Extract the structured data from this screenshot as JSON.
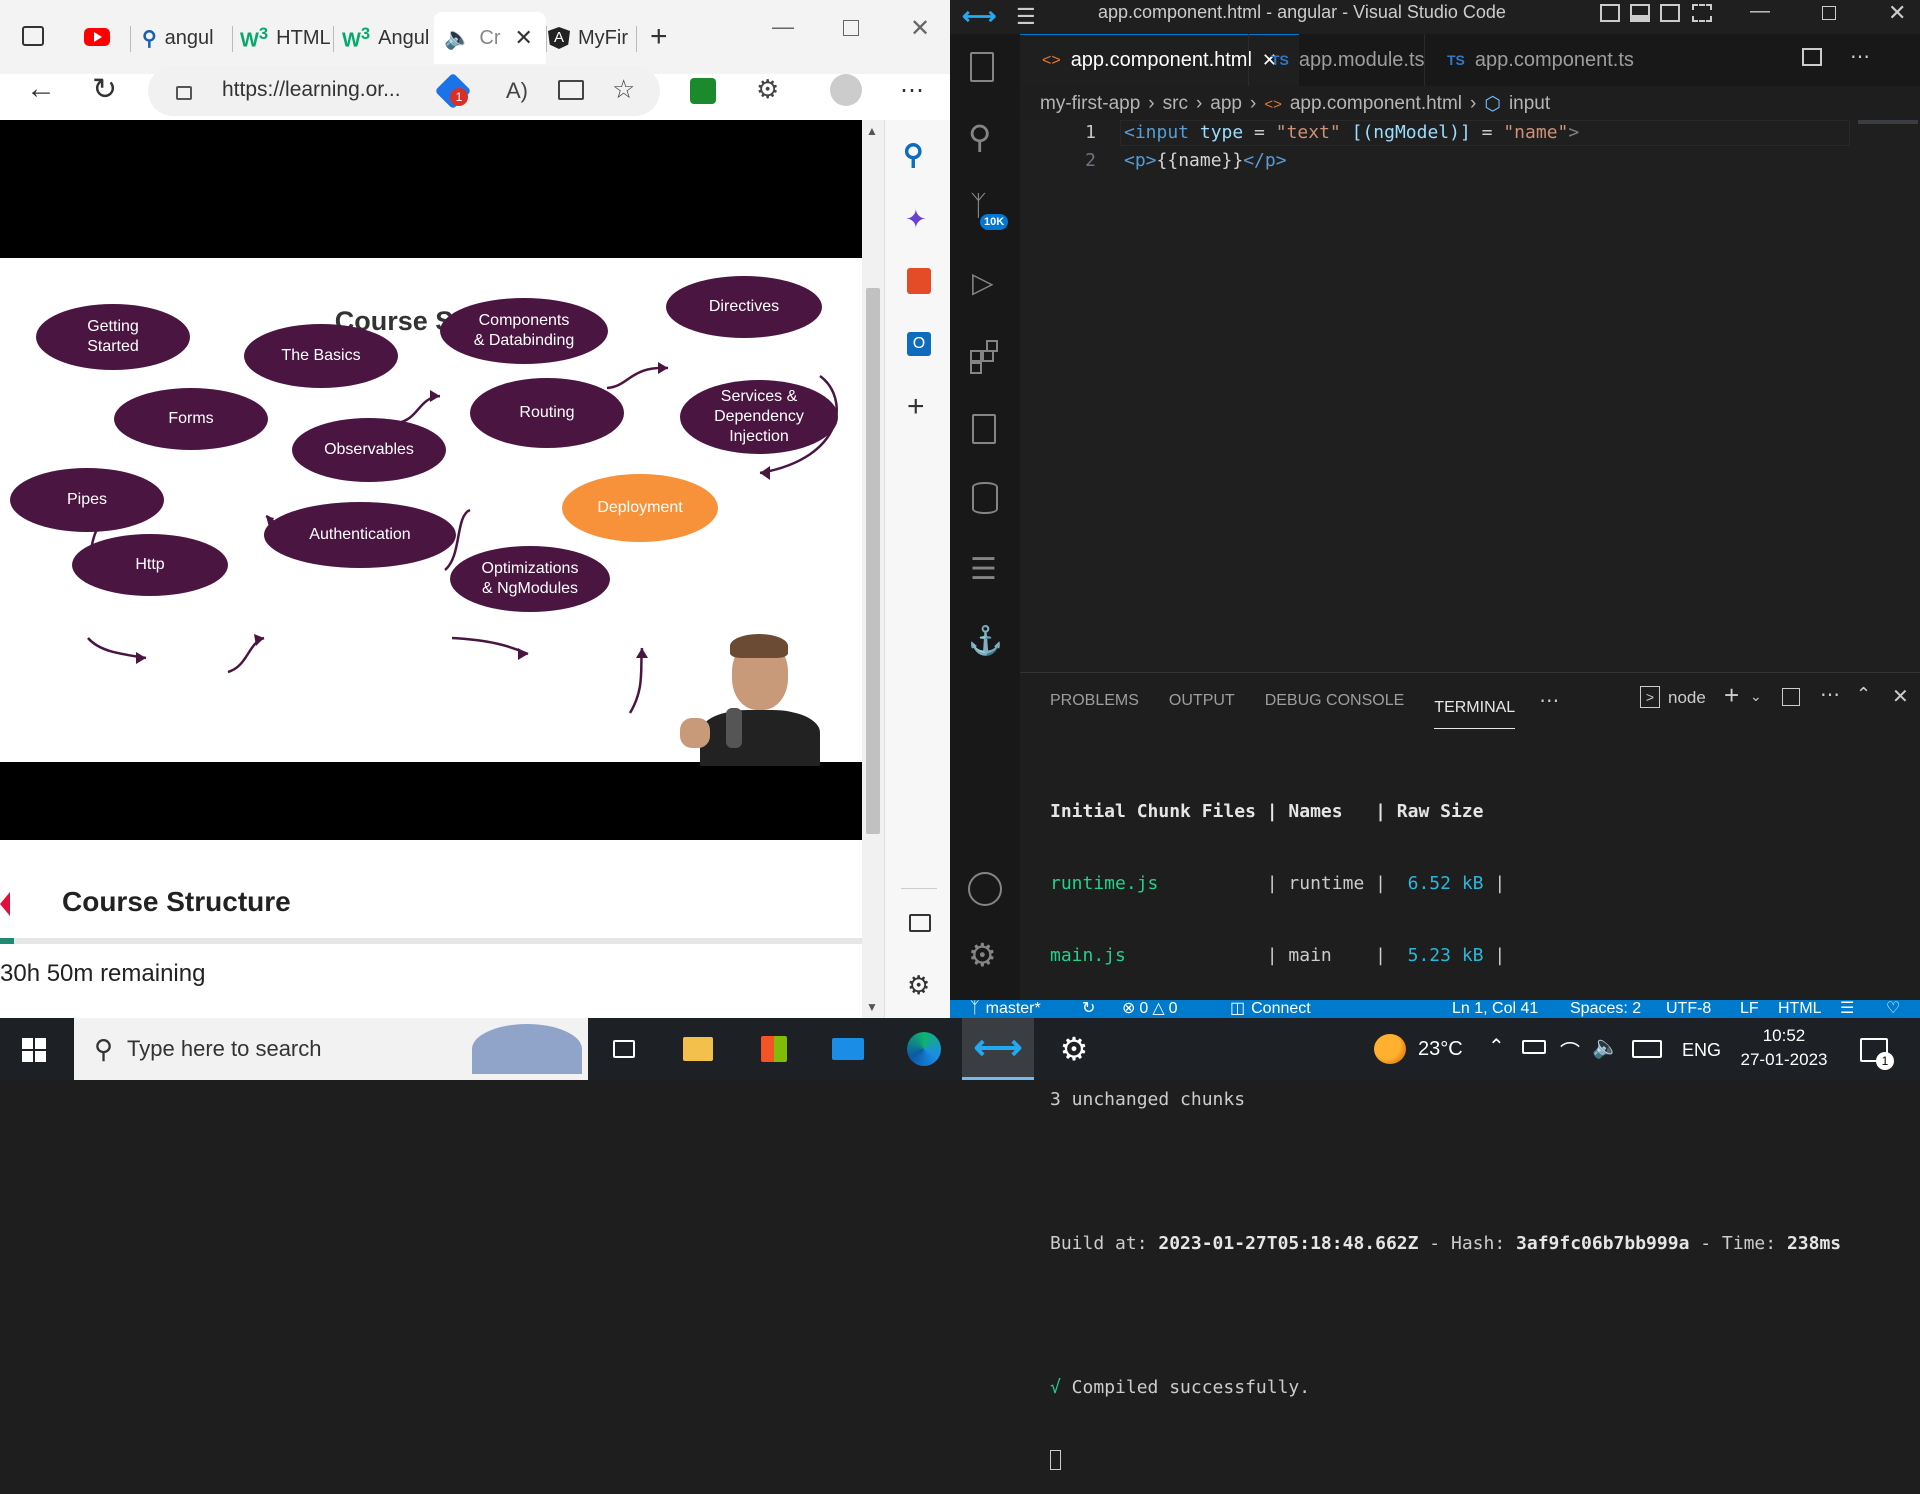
{
  "browser": {
    "tabs": [
      {
        "label": "angul"
      },
      {
        "label": "HTML"
      },
      {
        "label": "Angul"
      },
      {
        "label": "Cr"
      },
      {
        "label": "MyFir"
      }
    ],
    "url": "https://learning.or...",
    "notification_count": "1",
    "slide": {
      "title": "Course Structure",
      "nodes": [
        {
          "label": "Getting\nStarted"
        },
        {
          "label": "The Basics"
        },
        {
          "label": "Components\n& Databinding"
        },
        {
          "label": "Directives"
        },
        {
          "label": "Services &\nDependency\nInjection"
        },
        {
          "label": "Routing"
        },
        {
          "label": "Observables"
        },
        {
          "label": "Forms"
        },
        {
          "label": "Pipes"
        },
        {
          "label": "Http"
        },
        {
          "label": "Authentication"
        },
        {
          "label": "Optimizations\n& NgModules"
        },
        {
          "label": "Deployment"
        }
      ],
      "node_color": "#4b1542",
      "highlight_color": "#f7923a"
    },
    "course_title": "Course Structure",
    "remaining": "30h 50m remaining"
  },
  "vscode": {
    "window_title": "app.component.html - angular - Visual Studio Code",
    "tabs": [
      {
        "label": "app.component.html",
        "active": true
      },
      {
        "label": "app.module.ts"
      },
      {
        "label": "app.component.ts"
      }
    ],
    "tab_prefix_ts": "TS",
    "breadcrumbs": [
      "my-first-app",
      "src",
      "app",
      "app.component.html",
      "input"
    ],
    "scm_badge": "10K",
    "code_lines": [
      {
        "num": "1"
      },
      {
        "num": "2"
      }
    ],
    "code": {
      "l1_open": "<input ",
      "l1_attr1": "type",
      "l1_eq1": " = ",
      "l1_val1": "\"text\"",
      "l1_sp": " ",
      "l1_attr2": "[(ngModel)]",
      "l1_eq2": " = ",
      "l1_val2": "\"name\"",
      "l1_close": ">",
      "l2_open": "<p>",
      "l2_text": "{{name}}",
      "l2_close": "</p>"
    },
    "panel_tabs": [
      "PROBLEMS",
      "OUTPUT",
      "DEBUG CONSOLE",
      "TERMINAL"
    ],
    "terminal_name": "node",
    "terminal": {
      "header": "Initial Chunk Files | Names   | Raw Size",
      "row1_file": "runtime.js",
      "row1_mid": "          | runtime | ",
      "row1_size": " 6.52 kB",
      "row1_end": " |",
      "row2_file": "main.js",
      "row2_mid": "             | main    | ",
      "row2_size": " 5.23 kB",
      "row2_end": " |",
      "unchanged": "3 unchanged chunks",
      "build_label": "Build at: ",
      "build_time": "2023-01-27T05:18:48.662Z",
      "hash_label": " - Hash: ",
      "hash": "3af9fc06b7bb999a",
      "time_label": " - Time: ",
      "time": "238ms",
      "check": "√",
      "compiled": " Compiled successfully."
    },
    "status": {
      "branch": "master*",
      "errors": "0",
      "warnings": "0",
      "connect": "Connect",
      "position": "Ln 1, Col 41",
      "spaces": "Spaces: 2",
      "encoding": "UTF-8",
      "eol": "LF",
      "language": "HTML"
    }
  },
  "taskbar": {
    "search_placeholder": "Type here to search",
    "temperature": "23°C",
    "language": "ENG",
    "time": "10:52",
    "date": "27-01-2023",
    "notification_count": "1"
  },
  "colors": {
    "vscode_blue": "#007acc",
    "terminal_green": "#23d18b",
    "terminal_cyan": "#29b8db",
    "edge_blue": "#0f6cbd"
  }
}
